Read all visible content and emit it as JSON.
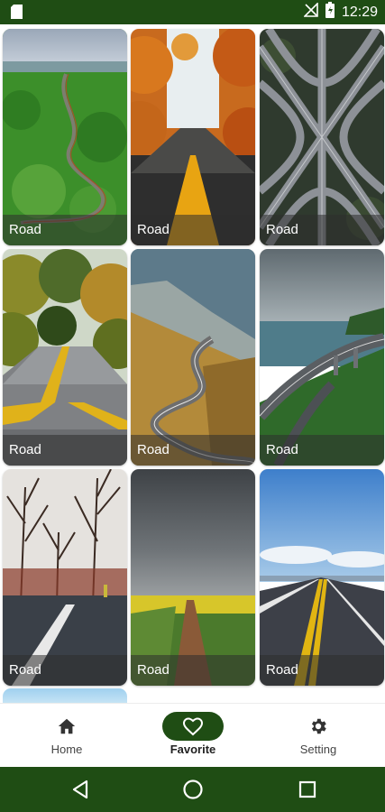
{
  "status_bar": {
    "time": "12:29",
    "icons": [
      "sd-card-icon",
      "no-signal-icon",
      "battery-icon"
    ]
  },
  "grid": {
    "tiles": [
      {
        "label": "Road",
        "scene": "aerial-winding-road-forest"
      },
      {
        "label": "Road",
        "scene": "autumn-road-yellow-line"
      },
      {
        "label": "Road",
        "scene": "highway-interchange"
      },
      {
        "label": "Road",
        "scene": "forest-road-curve"
      },
      {
        "label": "Road",
        "scene": "mountain-serpentine-road"
      },
      {
        "label": "Road",
        "scene": "coastal-bridge-road"
      },
      {
        "label": "Road",
        "scene": "bare-trees-road"
      },
      {
        "label": "Road",
        "scene": "dirt-path-storm-clouds"
      },
      {
        "label": "Road",
        "scene": "open-highway-blue-sky"
      }
    ]
  },
  "bottom_nav": {
    "items": [
      {
        "label": "Home",
        "icon": "home-icon",
        "active": false
      },
      {
        "label": "Favorite",
        "icon": "heart-icon",
        "active": true
      },
      {
        "label": "Setting",
        "icon": "gear-icon",
        "active": false
      }
    ]
  },
  "system_nav": [
    "back-icon",
    "home-circle-icon",
    "recents-icon"
  ],
  "colors": {
    "primary": "#1f4d14",
    "label_overlay": "#2d2d2d",
    "background": "#ffffff"
  }
}
